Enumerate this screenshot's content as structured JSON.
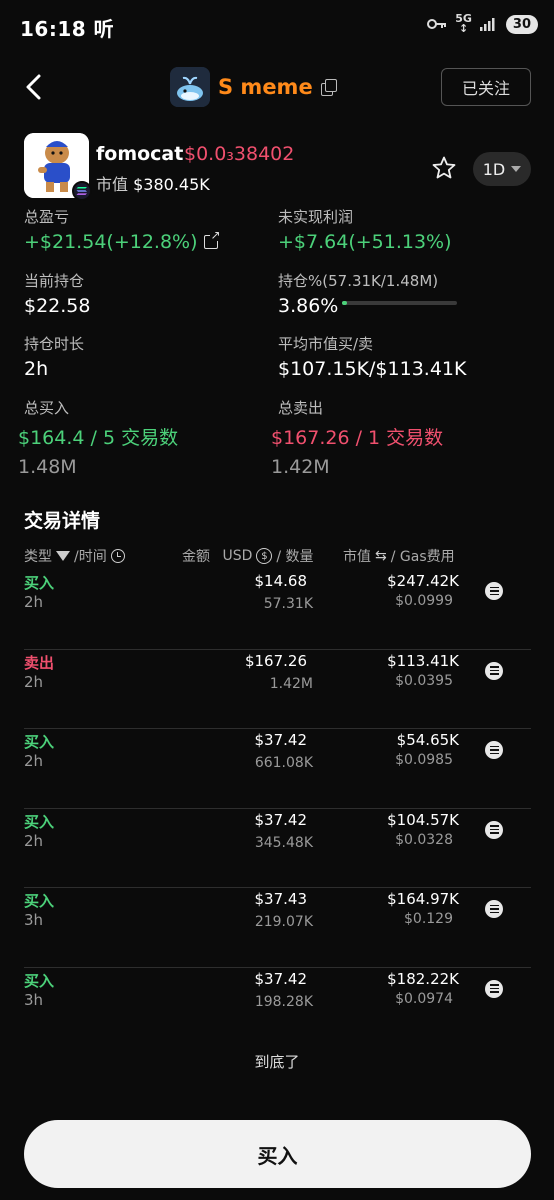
{
  "status_bar": {
    "time": "16:18",
    "extra": "听",
    "network_top": "5G",
    "network_bottom": "↕",
    "battery": "30"
  },
  "header": {
    "title": "S meme",
    "follow_label": "已关注"
  },
  "token": {
    "name": "fomocat",
    "price": "$0.0₃38402",
    "mcap_label": "市值",
    "mcap_value": "$380.45K",
    "period": "1D"
  },
  "stats": {
    "total_pnl_label": "总盈亏",
    "total_pnl_value": "+$21.54(+12.8%)",
    "unrealized_label": "未实现利润",
    "unrealized_value": "+$7.64(+51.13%)",
    "holding_label": "当前持仓",
    "holding_value": "$22.58",
    "holding_pct_label": "持仓%(57.31K/1.48M)",
    "holding_pct_value": "3.86%",
    "holding_pct_fraction": 0.0386,
    "duration_label": "持仓时长",
    "duration_value": "2h",
    "avg_mcap_label": "平均市值买/卖",
    "avg_mcap_value": "$107.15K/$113.41K",
    "total_buy_label": "总买入",
    "total_buy_value": "$164.4 / 5 交易数",
    "total_buy_qty": "1.48M",
    "total_sell_label": "总卖出",
    "total_sell_value": "$167.26 / 1 交易数",
    "total_sell_qty": "1.42M"
  },
  "trades": {
    "title": "交易详情",
    "col_type": "类型",
    "col_time": "/时间",
    "col_amount": "金额",
    "col_usd": "USD",
    "col_qty": "/ 数量",
    "col_mcap": "市值",
    "col_gas": "/ Gas费用",
    "rows": [
      {
        "type": "买入",
        "side": "buy",
        "time": "2h",
        "amount": "$14.68",
        "qty": "57.31K",
        "mcap": "$247.42K",
        "gas": "$0.0999"
      },
      {
        "type": "卖出",
        "side": "sell",
        "time": "2h",
        "amount": "$167.26",
        "qty": "1.42M",
        "mcap": "$113.41K",
        "gas": "$0.0395"
      },
      {
        "type": "买入",
        "side": "buy",
        "time": "2h",
        "amount": "$37.42",
        "qty": "661.08K",
        "mcap": "$54.65K",
        "gas": "$0.0985"
      },
      {
        "type": "买入",
        "side": "buy",
        "time": "2h",
        "amount": "$37.42",
        "qty": "345.48K",
        "mcap": "$104.57K",
        "gas": "$0.0328"
      },
      {
        "type": "买入",
        "side": "buy",
        "time": "3h",
        "amount": "$37.43",
        "qty": "219.07K",
        "mcap": "$164.97K",
        "gas": "$0.129"
      },
      {
        "type": "买入",
        "side": "buy",
        "time": "3h",
        "amount": "$37.42",
        "qty": "198.28K",
        "mcap": "$182.22K",
        "gas": "$0.0974"
      }
    ],
    "end_text": "到底了"
  },
  "buy_button": "买入",
  "colors": {
    "buy": "#4cd17a",
    "sell": "#f0506e",
    "accent": "#ff8a1a"
  }
}
